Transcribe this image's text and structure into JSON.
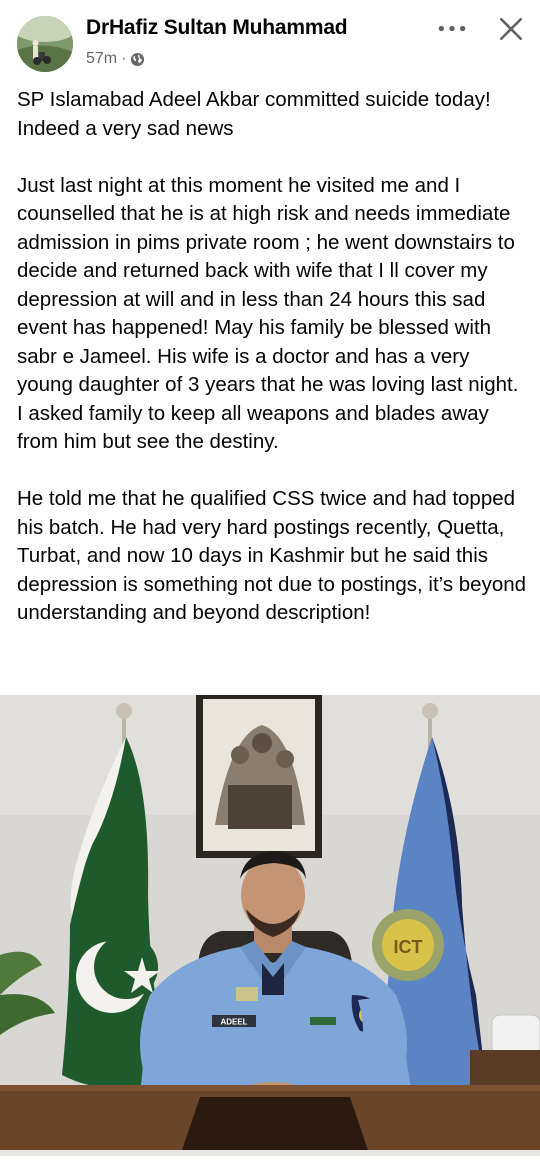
{
  "post": {
    "author": "DrHafiz Sultan Muhammad",
    "time": "57m",
    "separator": "·",
    "audience_icon": "globe-icon",
    "paragraphs": [
      "SP Islamabad Adeel Akbar committed suicide today! Indeed a very sad news",
      "Just last night at this moment he visited me and I counselled that he is at high risk and needs immediate admission in pims private room ; he went downstairs to decide and returned back with wife that I ll cover my depression at will and in less than 24 hours this sad event has happened! May his family be blessed with sabr e Jameel. His wife is a doctor and has a very young daughter of 3 years that he was loving last night.  I asked family to keep all weapons and blades away from him but see the destiny.",
      "He told me that he qualified CSS twice and had topped his batch. He had very hard postings recently, Quetta, Turbat, and now 10 days in Kashmir but he said this depression is something not due to postings, it’s beyond understanding and beyond description!"
    ],
    "photo": {
      "name_tag": "ADEEL"
    }
  },
  "colors": {
    "text": "#050505",
    "meta": "#65676b",
    "uniform": "#7ea6d8",
    "flag_green": "#1f5a2c",
    "police_flag": "#5b84c4"
  }
}
